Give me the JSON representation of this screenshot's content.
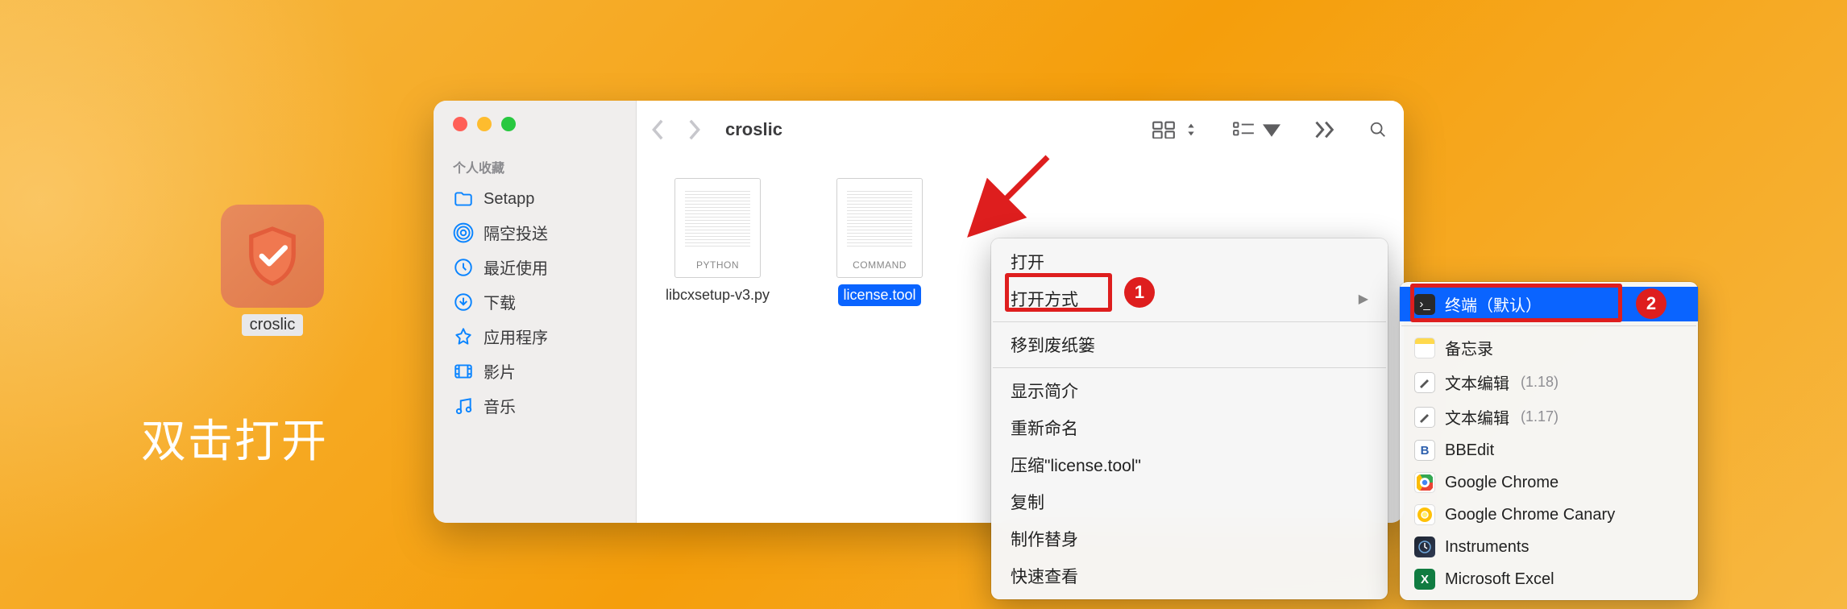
{
  "desktop": {
    "app_label": "croslic"
  },
  "instruction_text": "双击打开",
  "finder": {
    "title": "croslic",
    "sidebar": {
      "favorites_header": "个人收藏",
      "items": [
        {
          "label": "Setapp",
          "icon": "folder"
        },
        {
          "label": "隔空投送",
          "icon": "airdrop"
        },
        {
          "label": "最近使用",
          "icon": "clock"
        },
        {
          "label": "下载",
          "icon": "download"
        },
        {
          "label": "应用程序",
          "icon": "applications"
        },
        {
          "label": "影片",
          "icon": "movies"
        },
        {
          "label": "音乐",
          "icon": "music"
        }
      ]
    },
    "files": [
      {
        "name": "libcxsetup-v3.py",
        "tag": "PYTHON",
        "selected": false
      },
      {
        "name": "license.tool",
        "tag": "COMMAND",
        "selected": true
      }
    ]
  },
  "context_menu": {
    "items": [
      {
        "label": "打开",
        "type": "item"
      },
      {
        "label": "打开方式",
        "type": "submenu",
        "annotated": 1
      },
      {
        "type": "divider"
      },
      {
        "label": "移到废纸篓",
        "type": "item"
      },
      {
        "type": "divider"
      },
      {
        "label": "显示简介",
        "type": "item"
      },
      {
        "label": "重新命名",
        "type": "item"
      },
      {
        "label": "压缩\"license.tool\"",
        "type": "item"
      },
      {
        "label": "复制",
        "type": "item"
      },
      {
        "label": "制作替身",
        "type": "item"
      },
      {
        "label": "快速查看",
        "type": "item"
      }
    ]
  },
  "sub_menu": {
    "items": [
      {
        "label": "终端（默认）",
        "app": "terminal",
        "highlighted": true,
        "annotated": 2
      },
      {
        "type": "divider"
      },
      {
        "label": "备忘录",
        "app": "notes"
      },
      {
        "label": "文本编辑",
        "app": "textedit",
        "version": "(1.18)"
      },
      {
        "label": "文本编辑",
        "app": "textedit",
        "version": "(1.17)"
      },
      {
        "label": "BBEdit",
        "app": "bbedit"
      },
      {
        "label": "Google Chrome",
        "app": "chrome"
      },
      {
        "label": "Google Chrome Canary",
        "app": "canary"
      },
      {
        "label": "Instruments",
        "app": "instruments"
      },
      {
        "label": "Microsoft Excel",
        "app": "excel"
      }
    ]
  },
  "annotations": {
    "badge_1": "1",
    "badge_2": "2"
  }
}
